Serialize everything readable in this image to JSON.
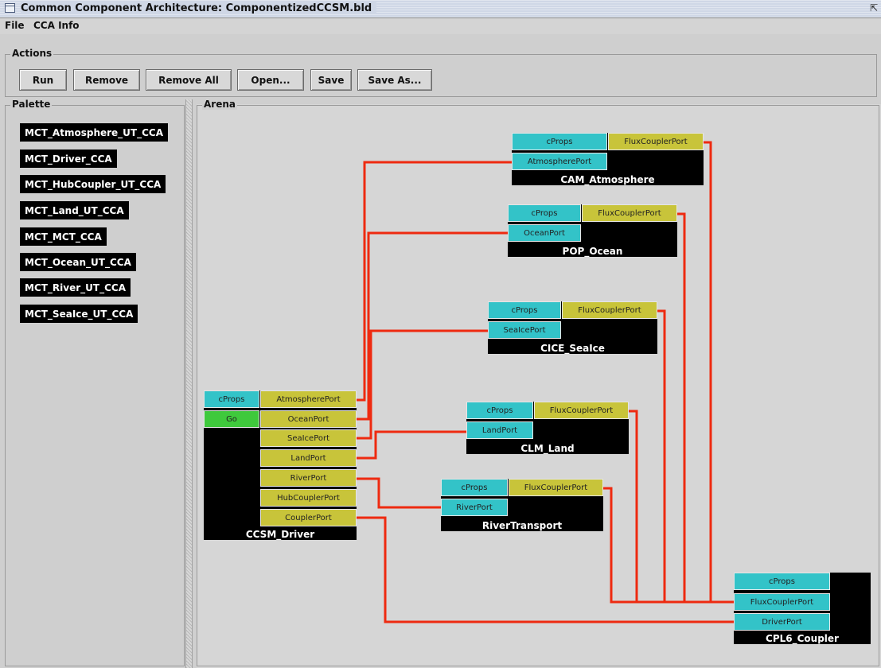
{
  "window": {
    "title": "Common Component Architecture: ComponentizedCCSM.bld"
  },
  "menu": {
    "file": "File",
    "cca_info": "CCA Info"
  },
  "actions": {
    "label": "Actions",
    "run": "Run",
    "remove": "Remove",
    "remove_all": "Remove All",
    "open": "Open...",
    "save": "Save",
    "save_as": "Save As..."
  },
  "palette": {
    "label": "Palette",
    "items": [
      "MCT_Atmosphere_UT_CCA",
      "MCT_Driver_CCA",
      "MCT_HubCoupler_UT_CCA",
      "MCT_Land_UT_CCA",
      "MCT_MCT_CCA",
      "MCT_Ocean_UT_CCA",
      "MCT_River_UT_CCA",
      "MCT_SeaIce_UT_CCA"
    ]
  },
  "arena": {
    "label": "Arena",
    "wire_color": "#ee2a10",
    "components": {
      "atm": {
        "name": "CAM_Atmosphere",
        "ports": [
          "cProps",
          "FluxCouplerPort",
          "AtmospherePort"
        ]
      },
      "ocean": {
        "name": "POP_Ocean",
        "ports": [
          "cProps",
          "FluxCouplerPort",
          "OceanPort"
        ]
      },
      "ice": {
        "name": "CICE_SeaIce",
        "ports": [
          "cProps",
          "FluxCouplerPort",
          "SeaIcePort"
        ]
      },
      "land": {
        "name": "CLM_Land",
        "ports": [
          "cProps",
          "FluxCouplerPort",
          "LandPort"
        ]
      },
      "river": {
        "name": "RiverTransport",
        "ports": [
          "cProps",
          "FluxCouplerPort",
          "RiverPort"
        ]
      },
      "driver": {
        "name": "CCSM_Driver",
        "ports": [
          "cProps",
          "Go",
          "AtmospherePort",
          "OceanPort",
          "SeaIcePort",
          "LandPort",
          "RiverPort",
          "HubCouplerPort",
          "CouplerPort"
        ]
      },
      "coupler": {
        "name": "CPL6_Coupler",
        "ports": [
          "cProps",
          "FluxCouplerPort",
          "DriverPort"
        ]
      }
    }
  }
}
